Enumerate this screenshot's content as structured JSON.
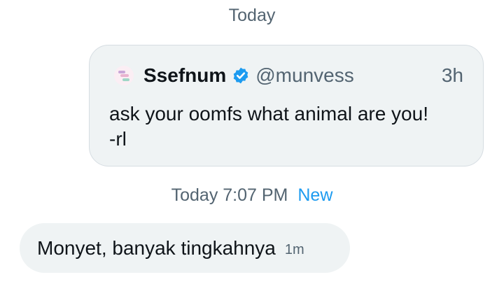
{
  "date_header": "Today",
  "quoted_post": {
    "author_name": "Ssefnum",
    "author_handle": "@munvess",
    "time_ago": "3h",
    "verified": true,
    "text": "ask your oomfs what animal are you!\n-rl"
  },
  "message_meta": {
    "timestamp": "Today 7:07 PM",
    "status": "New"
  },
  "message": {
    "text": "Monyet, banyak tingkahnya",
    "time_ago": "1m"
  },
  "colors": {
    "secondary_text": "#536471",
    "accent": "#1d9bf0",
    "bubble_bg": "#eff3f4",
    "primary_text": "#0f1419"
  }
}
